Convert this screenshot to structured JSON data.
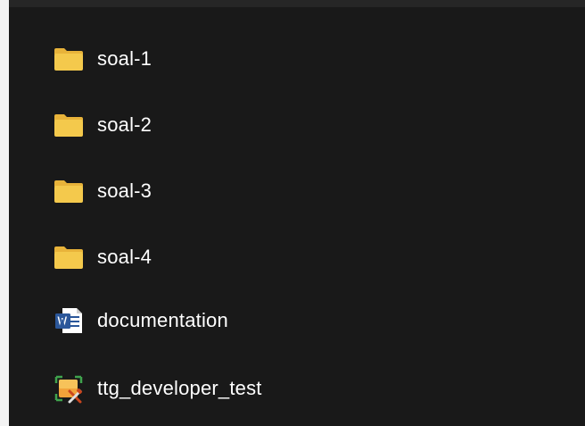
{
  "file_list": {
    "items": [
      {
        "name": "soal-1",
        "type": "folder",
        "icon": "folder-icon"
      },
      {
        "name": "soal-2",
        "type": "folder",
        "icon": "folder-icon"
      },
      {
        "name": "soal-3",
        "type": "folder",
        "icon": "folder-icon"
      },
      {
        "name": "soal-4",
        "type": "folder",
        "icon": "folder-icon"
      },
      {
        "name": "documentation",
        "type": "word-document",
        "icon": "word-document-icon"
      },
      {
        "name": "ttg_developer_test",
        "type": "project-file",
        "icon": "project-file-icon"
      }
    ]
  },
  "colors": {
    "background": "#191919",
    "text": "#ffffff",
    "folder": "#f4c94c",
    "word_blue": "#2b579a"
  }
}
